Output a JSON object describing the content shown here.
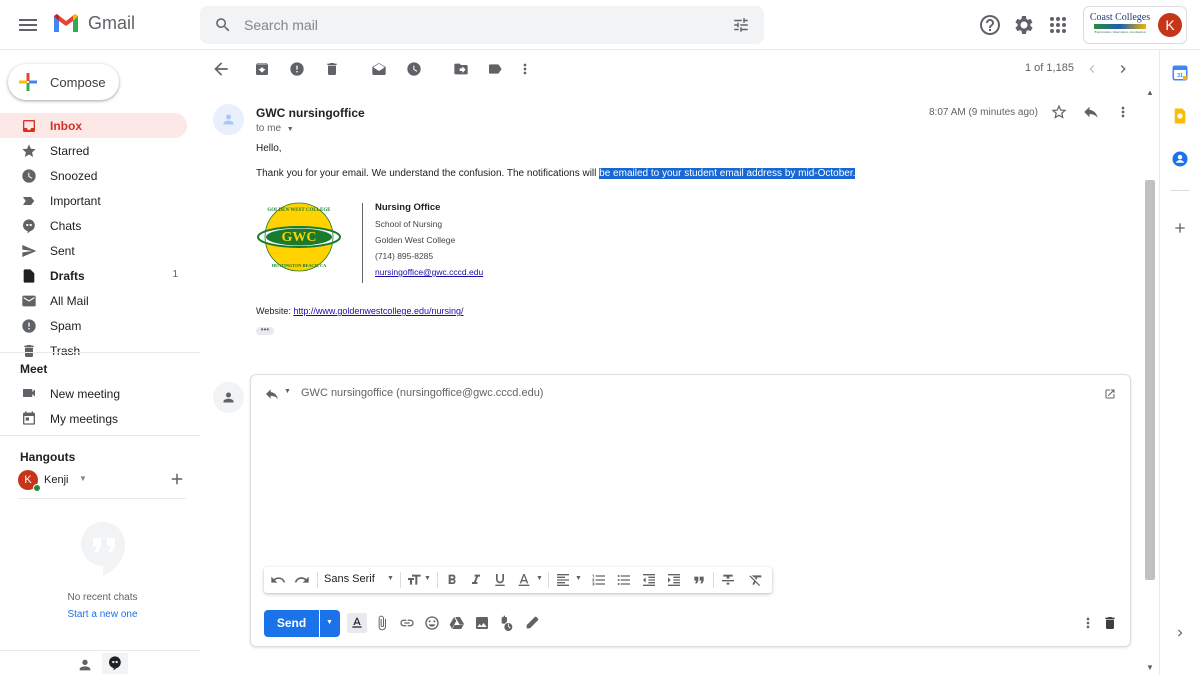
{
  "app": {
    "name": "Gmail"
  },
  "search": {
    "placeholder": "Search mail"
  },
  "org": {
    "line1": "Coast Colleges",
    "line2": "Exploration, Innovation, Graduation"
  },
  "account": {
    "initial": "K"
  },
  "compose": {
    "label": "Compose"
  },
  "nav": [
    {
      "label": "Inbox",
      "icon": "inbox-icon",
      "active": true,
      "count": ""
    },
    {
      "label": "Starred",
      "icon": "star-icon",
      "count": ""
    },
    {
      "label": "Snoozed",
      "icon": "clock-icon",
      "count": ""
    },
    {
      "label": "Important",
      "icon": "important-icon",
      "count": ""
    },
    {
      "label": "Chats",
      "icon": "chat-icon",
      "count": ""
    },
    {
      "label": "Sent",
      "icon": "send-icon",
      "count": ""
    },
    {
      "label": "Drafts",
      "icon": "draft-icon",
      "count": "1"
    },
    {
      "label": "All Mail",
      "icon": "mail-icon",
      "count": ""
    },
    {
      "label": "Spam",
      "icon": "spam-icon",
      "count": ""
    },
    {
      "label": "Trash",
      "icon": "trash-icon",
      "count": ""
    }
  ],
  "meet": {
    "title": "Meet",
    "items": [
      {
        "label": "New meeting"
      },
      {
        "label": "My meetings"
      }
    ]
  },
  "hangouts": {
    "title": "Hangouts",
    "user_initial": "K",
    "user_name": "Kenji",
    "no_chats": "No recent chats",
    "start_link": "Start a new one"
  },
  "pagination": {
    "text": "1 of 1,185"
  },
  "email": {
    "sender": "GWC nursingoffice",
    "to": "to me",
    "time": "8:07 AM (9 minutes ago)",
    "greeting": "Hello,",
    "body_plain": "Thank you for your email. We understand the confusion. The notifications will",
    "body_highlight": "be emailed to your student email address by mid-October.",
    "signature": {
      "logo_top": "GOLDEN WEST COLLEGE",
      "logo_mid": "GWC",
      "logo_bottom": "HUNTINGTON BEACH, CA",
      "title": "Nursing Office",
      "line1": "School of Nursing",
      "line2": "Golden West College",
      "phone": "(714) 895-8285",
      "email": "nursingoffice@gwc.cccd.edu"
    },
    "website_label": "Website:",
    "website_url": "http://www.goldenwestcollege.edu/nursing/"
  },
  "reply": {
    "recipient": "GWC nursingoffice (nursingoffice@gwc.cccd.edu)",
    "font": "Sans Serif",
    "send_label": "Send"
  },
  "colors": {
    "accent": "#1a73e8",
    "active_nav_bg": "#fce8e6",
    "active_nav_text": "#d93025",
    "highlight": "#1967d2"
  }
}
